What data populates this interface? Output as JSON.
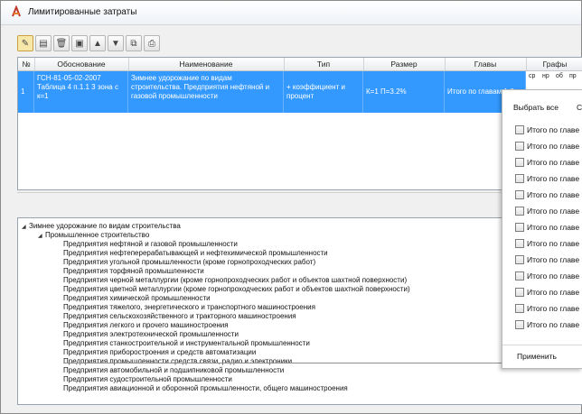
{
  "window": {
    "title": "Лимитированные затраты"
  },
  "toolbar": {
    "buttons": [
      "open-icon",
      "new-icon",
      "delete-icon",
      "save-icon",
      "move-up-icon",
      "move-down-icon",
      "copy-icon",
      "print-icon"
    ]
  },
  "grid": {
    "columns": [
      "№",
      "Обоснование",
      "Наименование",
      "Тип",
      "Размер",
      "Главы",
      "Графы"
    ],
    "row": {
      "num": "1",
      "basis": "ГСН-81-05-02-2007 Таблица 4 п.1.1 3 зона с к=1",
      "name": "Зимнее удорожание по видам строительства. Предприятия нефтяной и газовой промышленности",
      "type": "+ коэффициент и процент",
      "size": "К=1 П=3.2%",
      "chapters": "Итого по главам 1-8",
      "graf_labels": [
        "ср",
        "нр",
        "об",
        "пр"
      ]
    }
  },
  "tree": {
    "root": "Зимнее удорожание по видам строительства",
    "sub": "Промышленное строительство",
    "items": [
      "Предприятия нефтяной и газовой промышленности",
      "Предприятия нефтеперерабатывающей и нефтехимической промышленности",
      "Предприятия угольной промышленности (кроме горнопроходческих работ)",
      "Предприятия торфяной промышленности",
      "Предприятия черной металлургии (кроме горнопроходческих работ и объектов шахтной поверхности)",
      "Предприятия цветной металлургии (кроме горнопроходческих работ и объектов шахтной поверхности)",
      "Предприятия химической промышленности",
      "Предприятия тяжелого, энергетического и транспортного машиностроения",
      "Предприятия сельскохозяйственного и тракторного машиностроения",
      "Предприятия легкого и прочего машиностроения",
      "Предприятия электротехнической промышленности",
      "Предприятия станкостроительной и инструментальной промышленности",
      "Предприятия приборостроения и средств автоматизации",
      "Предприятия промышленности средств связи, радио и электроники",
      "Предприятия автомобильной и подшипниковой промышленности",
      "Предприятия судостроительной промышленности",
      "Предприятия авиационной и оборонной промышленности, общего машиностроения"
    ]
  },
  "dropdown": {
    "select_all": "Выбрать все",
    "partial_right": "С",
    "item_label": "Итого по главе",
    "count": 13,
    "apply": "Применить"
  }
}
